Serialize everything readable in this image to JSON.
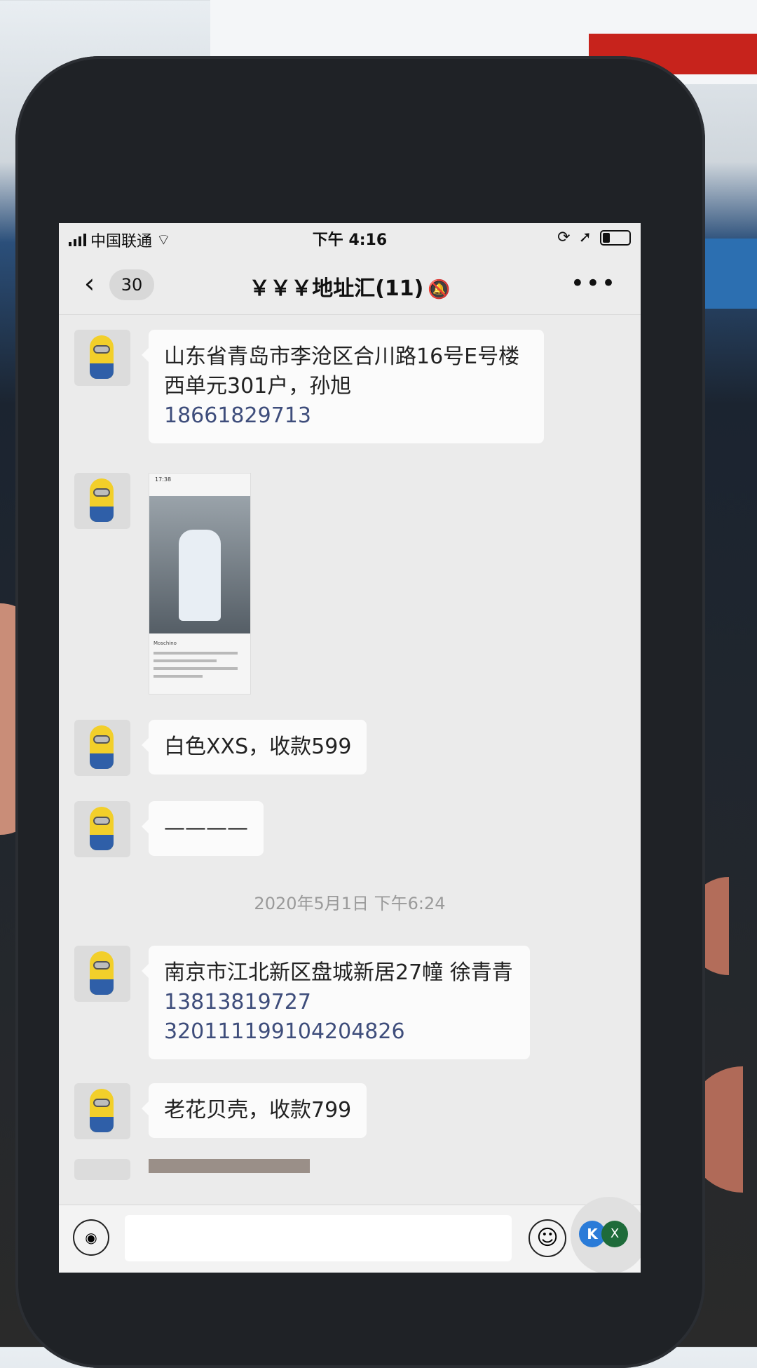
{
  "status_bar": {
    "carrier": "中国联通",
    "time": "下午 4:16"
  },
  "nav": {
    "back_count": "30",
    "title": "￥￥￥地址汇(11)"
  },
  "messages": [
    {
      "text": "山东省青岛市李沧区合川路16号E号楼西单元301户，孙旭",
      "phone": "18661829713"
    },
    {
      "image_lines": [
        "17:38",
        "Moschino"
      ]
    },
    {
      "text": "白色XXS，收款599"
    },
    {
      "text": "————"
    },
    {
      "text": "南京市江北新区盘城新居27幢 徐青青",
      "phone": "13813819727",
      "extra": "320111199104204826"
    },
    {
      "text": "老花贝壳，收款799"
    }
  ],
  "timestamp": "2020年5月1日 下午6:24",
  "float_buttons": {
    "left": "K",
    "right": "X"
  }
}
